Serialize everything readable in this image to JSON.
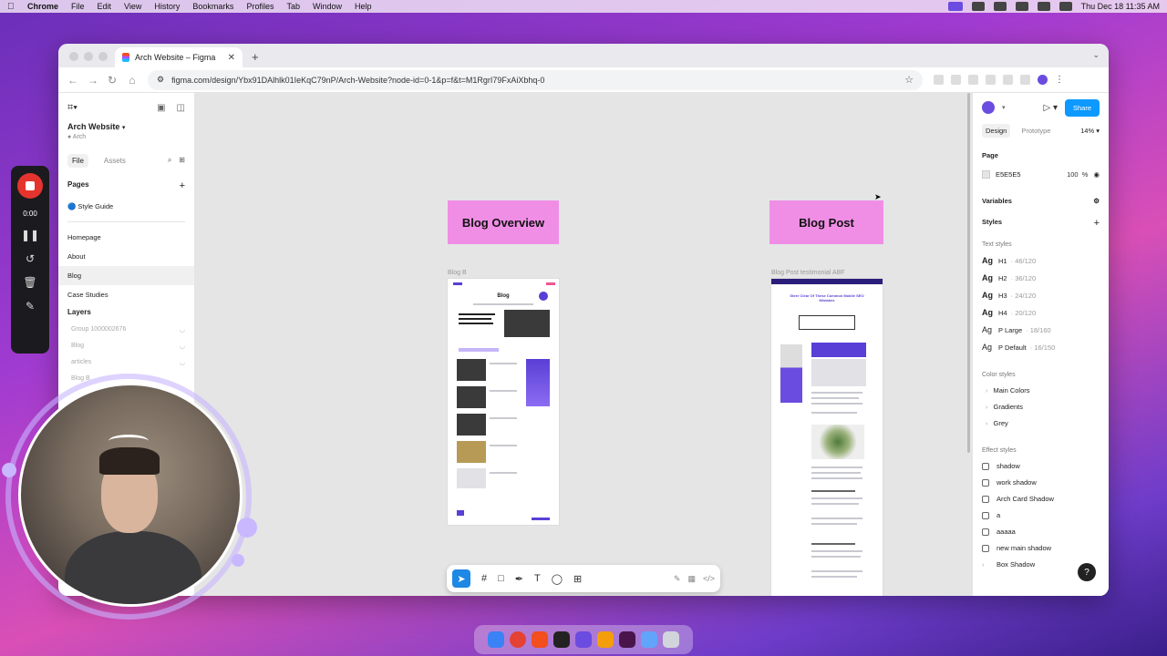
{
  "menubar": {
    "app": "Chrome",
    "items": [
      "File",
      "Edit",
      "View",
      "History",
      "Bookmarks",
      "Profiles",
      "Tab",
      "Window",
      "Help"
    ],
    "clock": "Thu Dec 18  11:35 AM"
  },
  "browser": {
    "tab_title": "Arch Website – Figma",
    "url": "figma.com/design/Ybx91DAlhlk01IeKqC79nP/Arch-Website?node-id=0-1&p=f&t=M1RgrI79FxAiXbhq-0"
  },
  "left_panel": {
    "project_name": "Arch Website",
    "team": "Arch",
    "file_tab": "File",
    "assets_tab": "Assets",
    "pages_header": "Pages",
    "pages": [
      {
        "label": "🔵 Style Guide"
      },
      {
        "label": "Homepage"
      },
      {
        "label": "About"
      },
      {
        "label": "Blog"
      },
      {
        "label": "Case Studies"
      }
    ],
    "layers_header": "Layers",
    "layers": [
      {
        "label": "Group 1000002676"
      },
      {
        "label": "Blog"
      },
      {
        "label": "articles"
      },
      {
        "label": "Blog B"
      }
    ]
  },
  "canvas": {
    "frame1_title": "Blog Overview",
    "frame2_title": "Blog Post",
    "frame1_label": "Blog B",
    "frame2_label": "Blog Post testimonial ABF",
    "blog_heading": "Blog",
    "post_heading": "Steer Clear Of These Common Mobile SEO Mistakes"
  },
  "right_panel": {
    "share_label": "Share",
    "design_tab": "Design",
    "prototype_tab": "Prototype",
    "zoom": "14%",
    "page_header": "Page",
    "page_color": "E5E5E5",
    "page_opacity": "100",
    "page_opacity_unit": "%",
    "variables_header": "Variables",
    "styles_header": "Styles",
    "text_styles_header": "Text styles",
    "text_styles": [
      {
        "name": "H1",
        "meta": "46/120"
      },
      {
        "name": "H2",
        "meta": "36/120"
      },
      {
        "name": "H3",
        "meta": "24/120"
      },
      {
        "name": "H4",
        "meta": "20/120"
      },
      {
        "name": "P Large",
        "meta": "18/160"
      },
      {
        "name": "P Default",
        "meta": "16/150"
      }
    ],
    "ag_label": "Ag",
    "color_styles_header": "Color styles",
    "color_styles": [
      "Main Colors",
      "Gradients",
      "Grey"
    ],
    "effect_styles_header": "Effect styles",
    "effect_styles": [
      "shadow",
      "work shadow",
      "Arch Card Shadow",
      "a",
      "aaaaa",
      "new main shadow",
      "Box Shadow"
    ],
    "help_label": "?"
  },
  "recorder": {
    "time": "0:00"
  },
  "colors": {
    "accent": "#0d99ff",
    "frame_pink": "#f08ee6",
    "brand_purple": "#5a3fd6"
  }
}
